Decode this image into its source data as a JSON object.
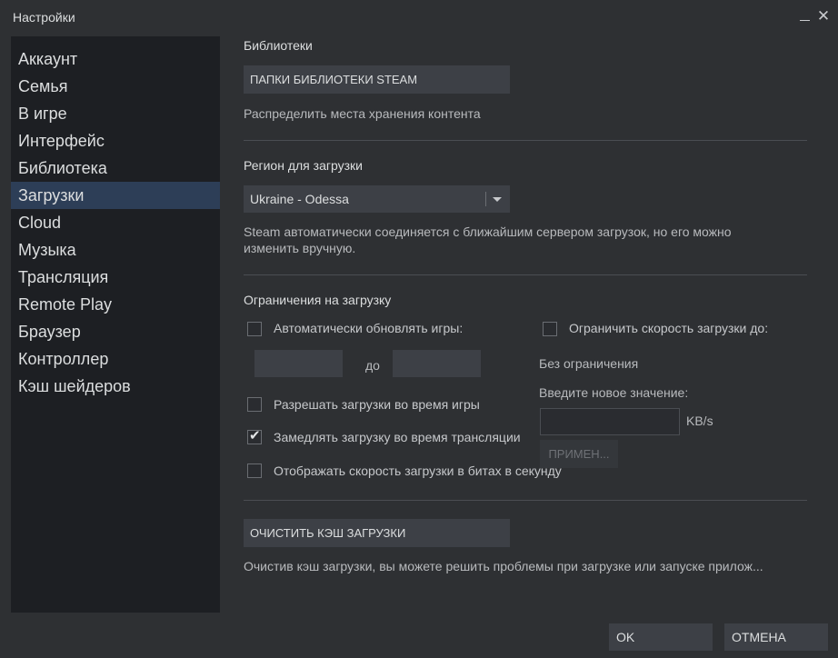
{
  "window": {
    "title": "Настройки",
    "minimize_glyph": "_",
    "close_glyph": "✕"
  },
  "sidebar": {
    "items": [
      {
        "label": "Аккаунт"
      },
      {
        "label": "Семья"
      },
      {
        "label": "В игре"
      },
      {
        "label": "Интерфейс"
      },
      {
        "label": "Библиотека"
      },
      {
        "label": "Загрузки",
        "active": true
      },
      {
        "label": "Cloud"
      },
      {
        "label": "Музыка"
      },
      {
        "label": "Трансляция"
      },
      {
        "label": "Remote Play"
      },
      {
        "label": "Браузер"
      },
      {
        "label": "Контроллер"
      },
      {
        "label": "Кэш шейдеров"
      }
    ]
  },
  "libraries": {
    "title": "Библиотеки",
    "button_label": "ПАПКИ БИБЛИОТЕКИ STEAM",
    "description": "Распределить места хранения контента"
  },
  "region": {
    "title": "Регион для загрузки",
    "selected": "Ukraine - Odessa",
    "description_line1": "Steam автоматически соединяется с ближайшим сервером загрузок, но его можно",
    "description_line2": "изменить вручную."
  },
  "limits": {
    "title": "Ограничения на загрузку",
    "auto_update": {
      "label": "Автоматически обновлять игры:",
      "checked": false
    },
    "time_from": "",
    "time_to_label": "до",
    "time_to": "",
    "allow_during_game": {
      "label": "Разрешать загрузки во время игры",
      "checked": false
    },
    "throttle_broadcast": {
      "label": "Замедлять загрузку во время трансляции",
      "checked": true
    },
    "show_bits": {
      "label": "Отображать скорость загрузки в битах в секунду",
      "checked": false
    },
    "limit_speed": {
      "label": "Ограничить скорость загрузки до:",
      "checked": false
    },
    "current_limit": "Без ограничения",
    "new_value_label": "Введите новое значение:",
    "new_value": "",
    "unit": "KB/s",
    "apply_label": "ПРИМЕН..."
  },
  "cache": {
    "button_label": "ОЧИСТИТЬ КЭШ ЗАГРУЗКИ",
    "description": "Очистив кэш загрузки, вы можете решить проблемы при загрузке или запуске прилож..."
  },
  "footer": {
    "ok_label": "OK",
    "cancel_label": "ОТМЕНА"
  },
  "colors": {
    "window_bg": "#2e3033",
    "sidebar_bg": "#1d1f23",
    "active_item_bg": "#2d3e57",
    "button_bg": "#3d4046"
  }
}
